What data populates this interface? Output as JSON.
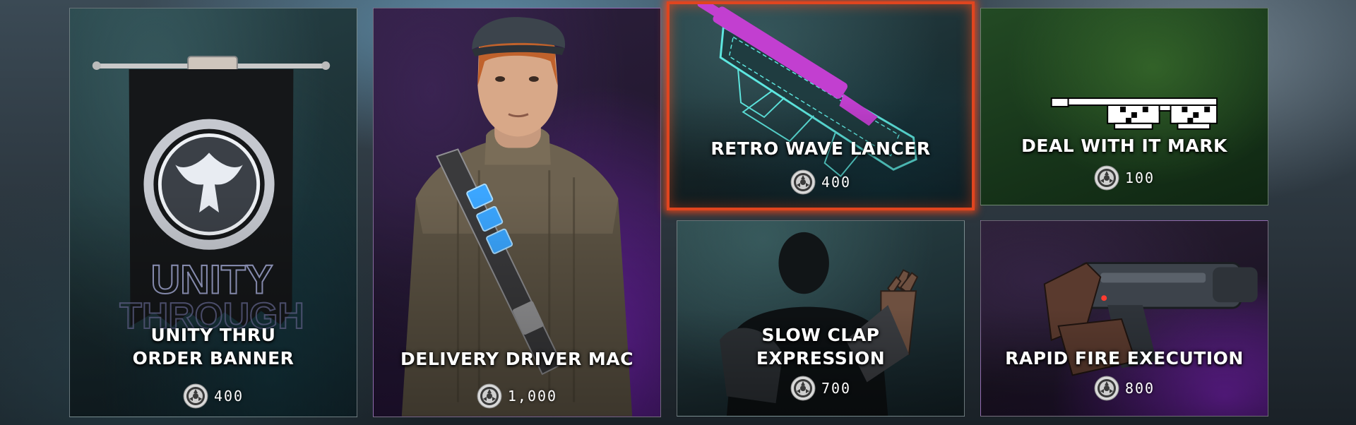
{
  "store": {
    "currency_icon": "iron-coin-icon",
    "accent_color": "#e0451f",
    "items": [
      {
        "title": "UNITY THRU ORDER BANNER",
        "price": "400",
        "selected": false
      },
      {
        "title": "DELIVERY DRIVER MAC",
        "price": "1,000",
        "selected": false
      },
      {
        "title": "RETRO WAVE LANCER",
        "price": "400",
        "selected": true
      },
      {
        "title": "DEAL WITH IT MARK",
        "price": "100",
        "selected": false
      },
      {
        "title": "SLOW CLAP EXPRESSION",
        "price": "700",
        "selected": false
      },
      {
        "title": "RAPID FIRE EXECUTION",
        "price": "800",
        "selected": false
      }
    ]
  }
}
